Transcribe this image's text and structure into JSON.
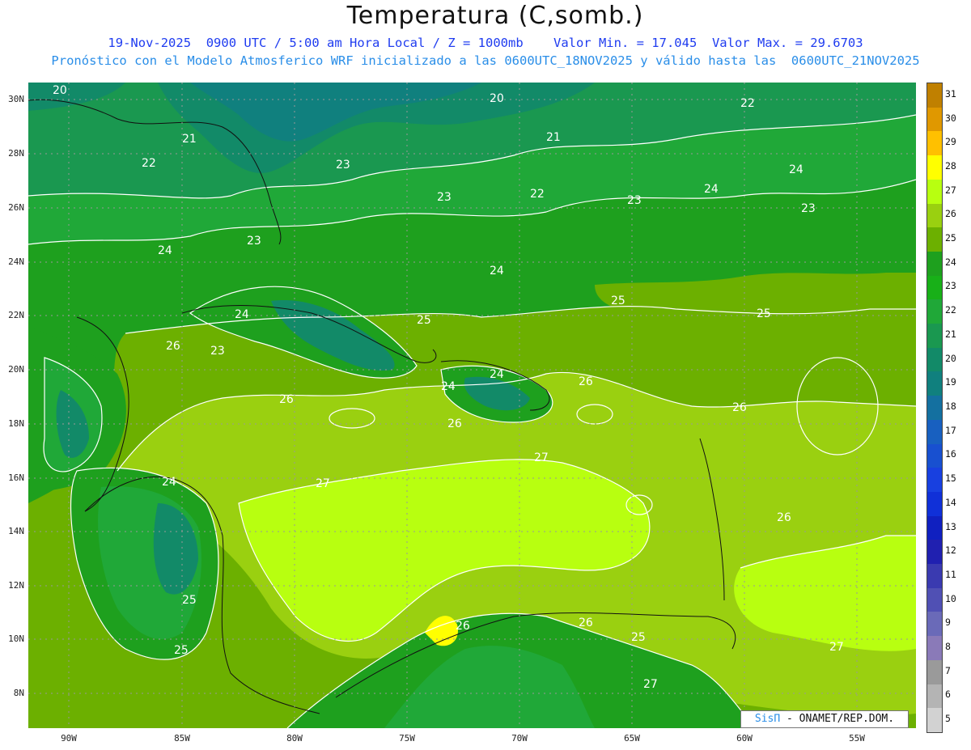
{
  "header": {
    "title": "Temperatura (C,somb.)",
    "subtitle_line1": "19-Nov-2025  0900 UTC / 5:00 am Hora Local / Z = 1000mb    Valor Min. = 17.045  Valor Max. = 29.6703",
    "subtitle_line2": "Pronóstico con el Modelo Atmosferico WRF inicializado a las 0600UTC_18NOV2025 y válido hasta las  0600UTC_21NOV2025"
  },
  "credit": {
    "brand": "SisΠ",
    "org": " - ONAMET/REP.DOM."
  },
  "axes": {
    "lat_labels": [
      "30N",
      "28N",
      "26N",
      "24N",
      "22N",
      "20N",
      "18N",
      "16N",
      "14N",
      "12N",
      "10N",
      "8N"
    ],
    "lon_labels": [
      "90W",
      "85W",
      "80W",
      "75W",
      "70W",
      "65W",
      "60W",
      "55W"
    ]
  },
  "contour_labels": [
    "20",
    "20",
    "21",
    "21",
    "22",
    "22",
    "22",
    "23",
    "23",
    "23",
    "23",
    "23",
    "23",
    "24",
    "24",
    "24",
    "24",
    "24",
    "24",
    "24",
    "24",
    "25",
    "25",
    "25",
    "25",
    "25",
    "25",
    "26",
    "26",
    "26",
    "26",
    "26",
    "26",
    "26",
    "26",
    "27",
    "27",
    "27",
    "27"
  ],
  "colorbar": {
    "labels": [
      "31",
      "30",
      "29",
      "28",
      "27",
      "26",
      "25",
      "24",
      "23",
      "22",
      "21",
      "20",
      "19",
      "18",
      "17",
      "16",
      "15",
      "14",
      "13",
      "12",
      "11",
      "10",
      "9",
      "8",
      "7",
      "6",
      "5"
    ],
    "colors": [
      "#c08000",
      "#e09800",
      "#ffc000",
      "#ffff00",
      "#b8ff10",
      "#9ad010",
      "#6cb000",
      "#1ea01e",
      "#18b018",
      "#20a838",
      "#1a9850",
      "#128a68",
      "#10807e",
      "#1470a0",
      "#1860c0",
      "#1850d0",
      "#1840e0",
      "#1030d8",
      "#1020c0",
      "#2020b0",
      "#3a3ab0",
      "#5050b4",
      "#6a6ab8",
      "#8a7ab8",
      "#9a9a9a",
      "#b4b4b4",
      "#d2d2d2"
    ]
  }
}
